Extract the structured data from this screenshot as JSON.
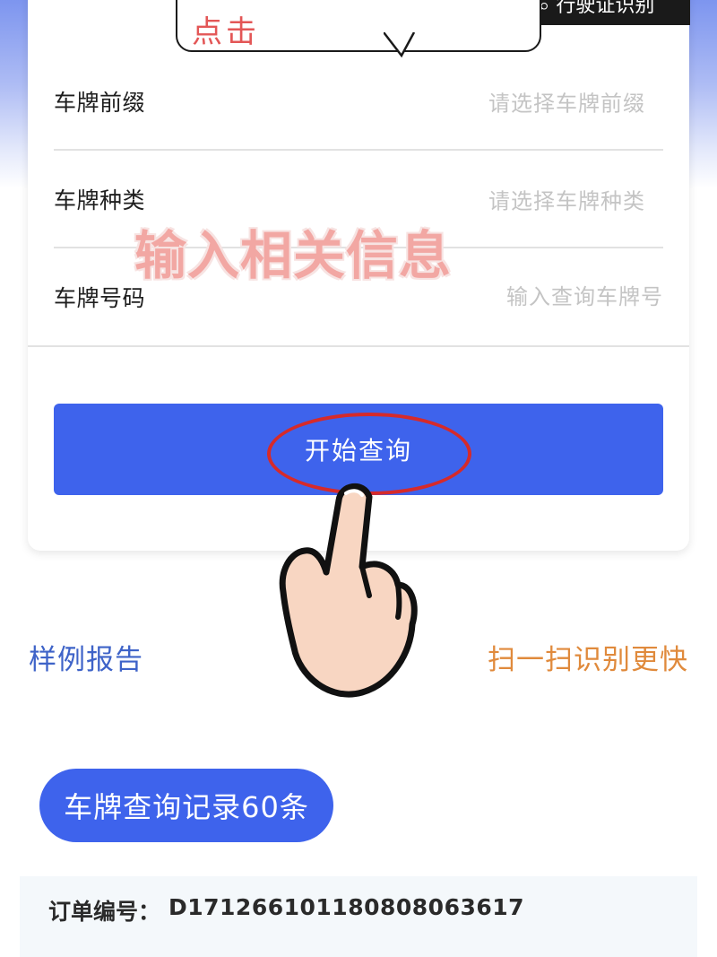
{
  "overlay": {
    "ocr_tag": "行驶证识别",
    "bubble_text": "点击",
    "caption": "输入相关信息"
  },
  "form": {
    "rows": [
      {
        "label": "车牌前缀",
        "placeholder": "请选择车牌前缀"
      },
      {
        "label": "车牌种类",
        "placeholder": "请选择车牌种类"
      },
      {
        "label": "车牌号码",
        "placeholder": "输入查询车牌号"
      }
    ],
    "submit_label": "开始查询"
  },
  "links": {
    "sample_report": "样例报告",
    "scan_faster": "扫一扫识别更快"
  },
  "records": {
    "label": "车牌查询记录60条"
  },
  "order": {
    "label": "订单编号：",
    "number": "D1712661011808080636​17"
  },
  "colors": {
    "accent": "#3e63ec",
    "link_blue": "#3e63c8",
    "link_orange": "#e08a3c",
    "annotation_red": "#d62a2a"
  }
}
